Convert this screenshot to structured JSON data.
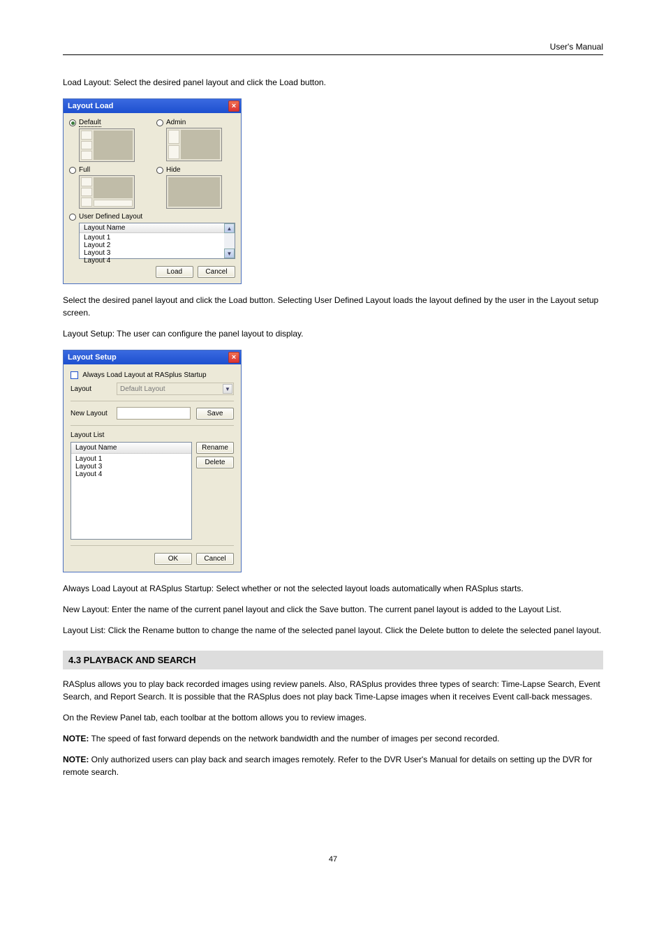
{
  "header_right": "User's Manual",
  "para_intro": "Load Layout: Select the desired panel layout and click the Load button.",
  "dlg1": {
    "title": "Layout Load",
    "opt_default": "Default",
    "opt_admin": "Admin",
    "opt_full": "Full",
    "opt_hide": "Hide",
    "opt_user": "User Defined Layout",
    "col_header": "Layout Name",
    "rows": [
      "Layout 1",
      "Layout 2",
      "Layout 3",
      "Layout 4"
    ],
    "btn_load": "Load",
    "btn_cancel": "Cancel"
  },
  "para_load": "Select the desired panel layout and click the Load button. Selecting User Defined Layout loads the layout defined by the user in the Layout setup screen.",
  "para_setup_intro": "Layout Setup: The user can configure the panel layout to display.",
  "dlg2": {
    "title": "Layout Setup",
    "chk": "Always Load Layout at RASplus Startup",
    "lbl_layout": "Layout",
    "dd_value": "Default Layout",
    "lbl_new": "New Layout",
    "btn_save": "Save",
    "lbl_list": "Layout List",
    "col_header": "Layout Name",
    "rows": [
      "Layout 1",
      "Layout 3",
      "Layout 4"
    ],
    "btn_rename": "Rename",
    "btn_delete": "Delete",
    "btn_ok": "OK",
    "btn_cancel": "Cancel"
  },
  "para_always": "Always Load Layout at RASplus Startup: Select whether or not the selected layout loads automatically when RASplus starts.",
  "para_new": "New Layout: Enter the name of the current panel layout and click the Save button. The current panel layout is added to the Layout List.",
  "para_list": "Layout List: Click the Rename button to change the name of the selected panel layout. Click the Delete button to delete the selected panel layout.",
  "section_4_3": "4.3 PLAYBACK AND SEARCH",
  "para_4_3": "RASplus allows you to play back recorded images using review panels. Also, RASplus provides three types of search: Time-Lapse Search, Event Search, and Report Search. It is possible that the RASplus does not play back Time-Lapse images when it receives Event call-back messages.",
  "para_panel": "On the Review Panel tab, each toolbar at the bottom allows you to review images.",
  "note_label": "NOTE:",
  "para_note1": " The speed of fast forward depends on the network bandwidth and the number of images per second recorded.",
  "para_note2": " Only authorized users can play back and search images remotely. Refer to the DVR User's Manual for details on setting up the DVR for remote search.",
  "footer_page": "47"
}
